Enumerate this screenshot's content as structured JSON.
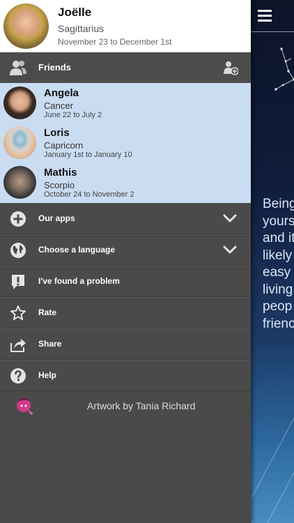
{
  "profile": {
    "name": "Joëlle",
    "sign": "Sagittarius",
    "dates": "November 23 to December 1st"
  },
  "friends_section": {
    "label": "Friends",
    "add_icon": "add-friend-icon",
    "icon": "friends-icon"
  },
  "friends": [
    {
      "name": "Angela",
      "sign": "Cancer",
      "dates": "June 22 to July 2"
    },
    {
      "name": "Loris",
      "sign": "Capricorn",
      "dates": "January 1st to January 10"
    },
    {
      "name": "Mathis",
      "sign": "Scorpio",
      "dates": "October 24 to November 2"
    }
  ],
  "menu": [
    {
      "label": "Our apps",
      "icon": "plus-circle-icon",
      "has_chevron": true
    },
    {
      "label": "Choose a language",
      "icon": "globe-icon",
      "has_chevron": true
    },
    {
      "label": "I've found a problem",
      "icon": "exclamation-icon",
      "has_chevron": false
    },
    {
      "label": "Rate",
      "icon": "star-icon",
      "has_chevron": false
    },
    {
      "label": "Share",
      "icon": "share-icon",
      "has_chevron": false
    },
    {
      "label": "Help",
      "icon": "help-icon",
      "has_chevron": false
    }
  ],
  "credit": {
    "text": "Artwork by Tania Richard",
    "icon": "artist-logo-icon"
  },
  "main_preview": {
    "text_lines": [
      "Being",
      "yours",
      "and it",
      "likely",
      "easy",
      "living",
      "peop",
      "frienc"
    ],
    "menu_icon": "hamburger-menu-icon"
  },
  "colors": {
    "drawer_bg": "#4a4a4a",
    "friends_bg": "#c9dcf2",
    "profile_bg": "#ffffff",
    "main_bg_top": "#0c1428",
    "main_bg_bottom": "#4a8cc0"
  }
}
